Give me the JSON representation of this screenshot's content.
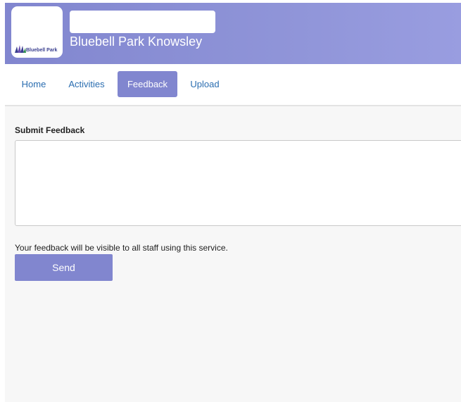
{
  "header": {
    "logo_text": "Bluebell Park",
    "site_title": "Bluebell Park Knowsley",
    "title_placeholder_value": ""
  },
  "nav": {
    "tabs": [
      {
        "label": "Home",
        "active": false
      },
      {
        "label": "Activities",
        "active": false
      },
      {
        "label": "Feedback",
        "active": true
      },
      {
        "label": "Upload",
        "active": false
      }
    ]
  },
  "feedback": {
    "label": "Submit Feedback",
    "value": "",
    "notice": "Your feedback will be visible to all staff using this service.",
    "send_label": "Send"
  },
  "colors": {
    "accent": "#8186cf",
    "link": "#2a6db0",
    "content_bg": "#f7f7f7"
  }
}
